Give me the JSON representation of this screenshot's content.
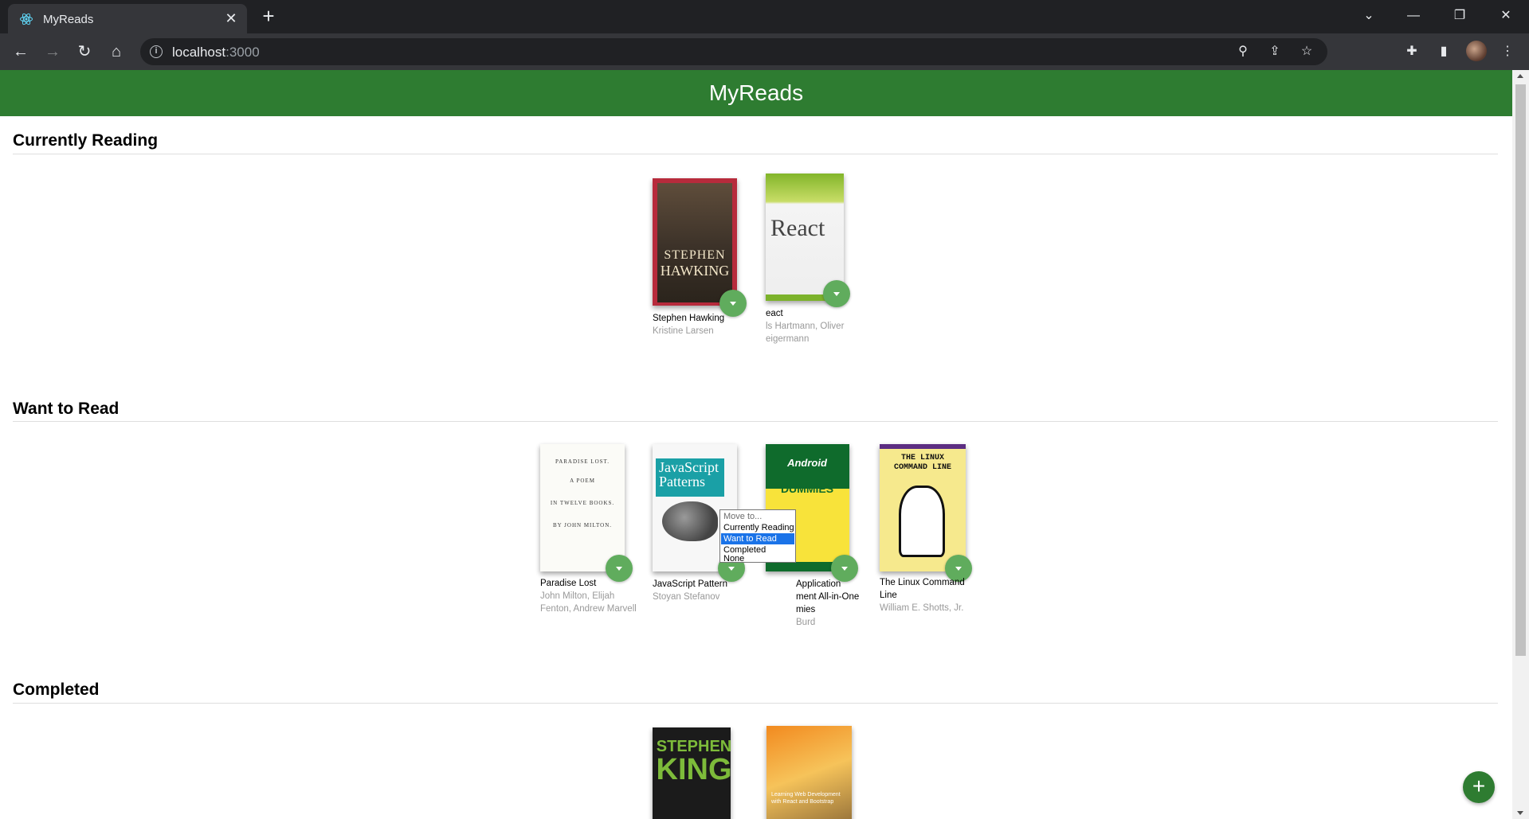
{
  "browser": {
    "tab_title": "MyReads",
    "url_host": "localhost",
    "url_port": ":3000",
    "new_tab_glyph": "+",
    "close_glyph": "✕"
  },
  "app": {
    "title": "MyReads",
    "accent_color": "#2e7c31",
    "changer_color": "#60ac5d",
    "add_button_glyph": "+"
  },
  "shelves": [
    {
      "title": "Currently Reading",
      "books": [
        {
          "title": "Stephen Hawking",
          "authors": "Kristine Larsen",
          "cover_text": [
            "STEPHEN",
            "HAWKING"
          ]
        },
        {
          "title": "eact",
          "authors_lines": [
            "ls Hartmann, Oliver",
            "eigermann"
          ],
          "cover_text": [
            "React"
          ]
        }
      ]
    },
    {
      "title": "Want to Read",
      "books": [
        {
          "title": "Paradise Lost",
          "authors_lines": [
            "John Milton, Elijah",
            "Fenton, Andrew Marvell"
          ],
          "cover_text": [
            "PARADISE LOST.",
            "A POEM",
            "IN TWELVE BOOKS.",
            "BY JOHN MILTON."
          ]
        },
        {
          "title": "JavaScript Pattern",
          "authors": "Stoyan Stefanov",
          "cover_text": [
            "JavaScript",
            "Patterns"
          ]
        },
        {
          "title_lines": [
            "Application",
            "ment All-in-One",
            "mies"
          ],
          "authors": "Burd",
          "cover_text": [
            "Android",
            "DUMMIES"
          ]
        },
        {
          "title_lines": [
            "The Linux Command",
            "Line"
          ],
          "authors": "William E. Shotts, Jr.",
          "cover_text": [
            "THE LINUX",
            "COMMAND LINE"
          ]
        }
      ]
    },
    {
      "title": "Completed",
      "books": [
        {
          "cover_text": [
            "STEPHEN",
            "KING"
          ]
        },
        {
          "cover_text": [
            "Learning Web Development with React and Bootstrap"
          ]
        }
      ]
    }
  ],
  "shelf_menu": {
    "options": [
      "Move to...",
      "Currently Reading",
      "Want to Read",
      "Completed",
      "None"
    ],
    "selected": "Want to Read"
  }
}
